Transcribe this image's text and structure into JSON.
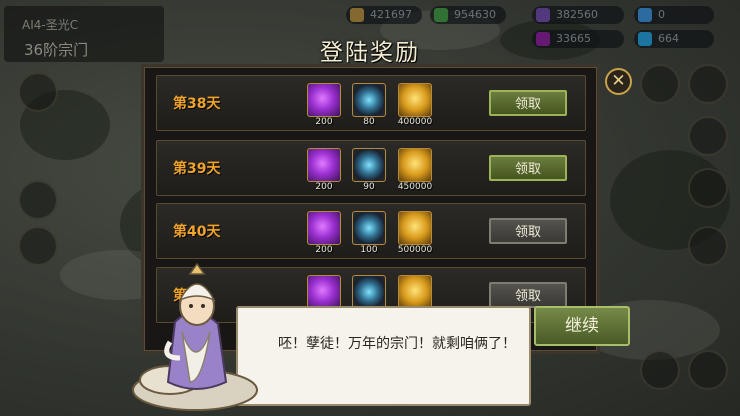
{
  "hud": {
    "info_sub": "AI4-圣光C",
    "info_title": "36阶宗门",
    "resources": [
      {
        "value": "421697",
        "color": "#c9a24a",
        "icon": "coin-icon"
      },
      {
        "value": "954630",
        "color": "#4caf50",
        "icon": "wood-icon"
      },
      {
        "value": "382560",
        "color": "#7e57c2",
        "icon": "stone-icon"
      },
      {
        "value": "0",
        "color": "#42a5f5",
        "icon": "gem-icon"
      },
      {
        "value": "33665",
        "color": "#9c27b0",
        "icon": "crystal-icon"
      },
      {
        "value": "664",
        "color": "#29b6f6",
        "icon": "feather-icon"
      }
    ]
  },
  "dialog": {
    "title": "登陆奖励",
    "close_icon": "close-x-icon",
    "rows": [
      {
        "day": "第38天",
        "items": [
          {
            "type": "crystal",
            "qty": "200"
          },
          {
            "type": "orb",
            "qty": "80"
          },
          {
            "type": "gold",
            "qty": "400000"
          }
        ],
        "button": "领取",
        "active": true
      },
      {
        "day": "第39天",
        "items": [
          {
            "type": "crystal",
            "qty": "200"
          },
          {
            "type": "orb",
            "qty": "90"
          },
          {
            "type": "gold",
            "qty": "450000"
          }
        ],
        "button": "领取",
        "active": true
      },
      {
        "day": "第40天",
        "items": [
          {
            "type": "crystal",
            "qty": "200"
          },
          {
            "type": "orb",
            "qty": "100"
          },
          {
            "type": "gold",
            "qty": "500000"
          }
        ],
        "button": "领取",
        "active": false
      },
      {
        "day": "第4",
        "items": [
          {
            "type": "crystal",
            "qty": ""
          },
          {
            "type": "orb",
            "qty": ""
          },
          {
            "type": "gold",
            "qty": ""
          }
        ],
        "button": "领取",
        "active": false
      }
    ]
  },
  "speech": {
    "text": "呸！孽徒！万年的宗门！就剩咱俩了！",
    "continue_label": "继续"
  },
  "colors": {
    "accent": "#f0a42a",
    "active_button": "#5a6d2e",
    "panel_border": "#5a4a32"
  }
}
